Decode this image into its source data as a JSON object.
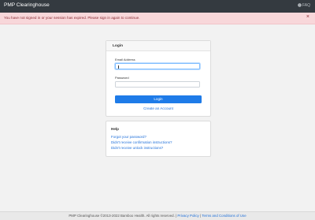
{
  "navbar": {
    "brand": "PMP Clearinghouse",
    "faq_label": "FAQ"
  },
  "alert": {
    "message": "You have not signed in or your session has expired. Please sign in again to continue.",
    "close": "×"
  },
  "login": {
    "title": "Login",
    "email_label": "Email Address",
    "email_value": "",
    "password_label": "Password",
    "password_value": "",
    "button_label": "Login",
    "create_account": "Create an Account"
  },
  "help": {
    "title": "Help",
    "links": [
      "Forgot your password?",
      "Didn't receive confirmation instructions?",
      "Didn't receive unlock instructions?"
    ]
  },
  "footer": {
    "copyright": "PMP Clearinghouse ©2013-2022 Bamboo Health. All rights reserved. |",
    "privacy": "Privacy Policy",
    "sep": "|",
    "terms": "Terms and Conditions of Use"
  },
  "colors": {
    "navbar": "#343a40",
    "alert_bg": "#f8d7da",
    "primary": "#1e7be8"
  }
}
